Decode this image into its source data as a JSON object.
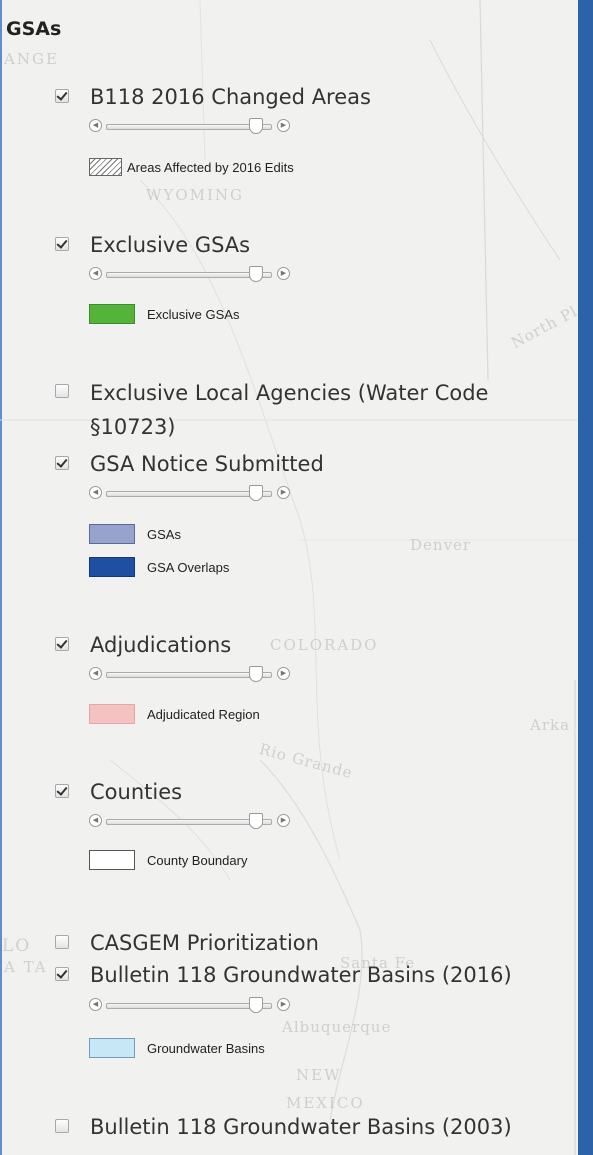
{
  "panel": {
    "title": "GSAs",
    "colors": {
      "exclusive_gsas": "#55b33a",
      "gsas": "#97a3cc",
      "gsa_overlaps": "#1f4fa3",
      "adjudicated_region": "#f6c1c1",
      "county_boundary": "#ffffff",
      "groundwater_basins": "#c6e7f6"
    }
  },
  "map_labels": {
    "wyoming": "WYOMING",
    "denver": "Denver",
    "colorado": "COLORADO",
    "santa_fe": "Santa Fe",
    "albuquerque": "Albuquerque",
    "new": "NEW",
    "mexico": "MEXICO",
    "rio_grande": "Rio Grande",
    "north_pl": "North Pl",
    "arka": "Arka",
    "ange": "ANGE",
    "lo": "LO",
    "ata": "A TA"
  },
  "layers": [
    {
      "name": "B118 2016 Changed Areas",
      "checked": true,
      "slider": {
        "opacity": 0.95
      },
      "legend": [
        {
          "label": "Areas Affected by 2016 Edits",
          "swatch": "hatch"
        }
      ]
    },
    {
      "name": "Exclusive GSAs",
      "checked": true,
      "slider": {
        "opacity": 0.95
      },
      "legend": [
        {
          "label": "Exclusive GSAs",
          "color": "#55b33a"
        }
      ]
    },
    {
      "name": "Exclusive Local Agencies (Water Code §10723)",
      "checked": false
    },
    {
      "name": "GSA Notice Submitted",
      "checked": true,
      "slider": {
        "opacity": 0.95
      },
      "legend": [
        {
          "label": "GSAs",
          "color": "#97a3cc"
        },
        {
          "label": "GSA Overlaps",
          "color": "#1f4fa3"
        }
      ]
    },
    {
      "name": "Adjudications",
      "checked": true,
      "slider": {
        "opacity": 0.95
      },
      "legend": [
        {
          "label": "Adjudicated Region",
          "color": "#f6c1c1"
        }
      ]
    },
    {
      "name": "Counties",
      "checked": true,
      "slider": {
        "opacity": 0.95
      },
      "legend": [
        {
          "label": "County Boundary",
          "color": "#ffffff"
        }
      ]
    },
    {
      "name": "CASGEM Prioritization",
      "checked": false
    },
    {
      "name": "Bulletin 118 Groundwater Basins (2016)",
      "checked": true,
      "slider": {
        "opacity": 0.95
      },
      "legend": [
        {
          "label": "Groundwater Basins",
          "color": "#c6e7f6"
        }
      ]
    },
    {
      "name": "Bulletin 118 Groundwater Basins (2003)",
      "checked": false
    }
  ]
}
